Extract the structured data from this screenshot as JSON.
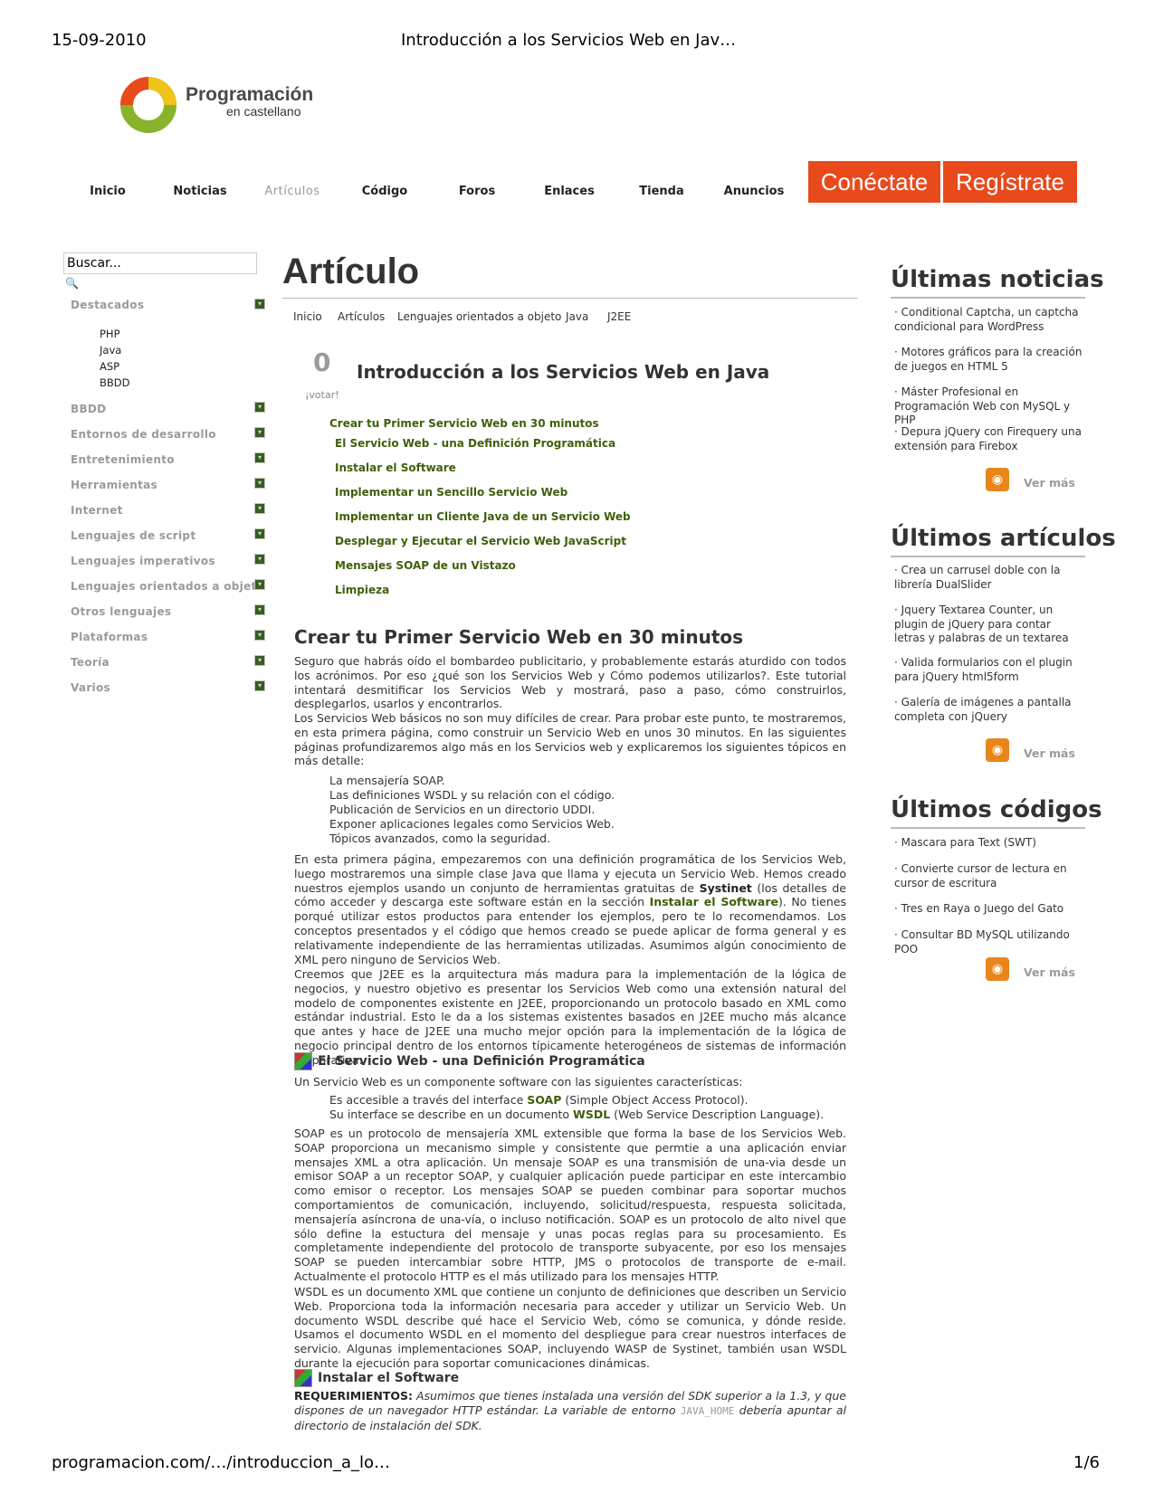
{
  "print": {
    "date": "15-09-2010",
    "doc_title": "Introducción a los Servicios Web en Jav…",
    "url": "programacion.com/…/introduccion_a_lo…",
    "page": "1/6"
  },
  "logo": {
    "line1": "Programación",
    "line2": "en castellano"
  },
  "nav": {
    "items": [
      "Inicio",
      "Noticias",
      "Artículos",
      "Código",
      "Foros",
      "Enlaces",
      "Tienda",
      "Anuncios"
    ],
    "connect": "Conéctate",
    "register": "Regístrate"
  },
  "sidebar": {
    "search_value": "Buscar...",
    "categories": [
      "Destacados",
      "BBDD",
      "Entornos de desarrollo",
      "Entretenimiento",
      "Herramientas",
      "Internet",
      "Lenguajes de script",
      "Lenguajes imperativos",
      "Lenguajes orientados a objeto",
      "Otros lenguajes",
      "Plataformas",
      "Teoría",
      "Varios"
    ],
    "sub_items": [
      "PHP",
      "Java",
      "ASP",
      "BBDD"
    ]
  },
  "main": {
    "title": "Artículo",
    "breadcrumb": [
      "Inicio",
      "Artículos",
      "Lenguajes orientados a objeto",
      "Java",
      "J2EE"
    ],
    "vote_count": "0",
    "vote_label": "¡votar!",
    "article_title": "Introducción a los Servicios Web en Java",
    "toc": [
      "Crear tu Primer Servicio Web en 30 minutos",
      "El Servicio Web - una Definición Programática",
      "Instalar el Software",
      "Implementar un Sencillo Servicio Web",
      "Implementar un Cliente Java de un Servicio Web",
      "Desplegar y Ejecutar el Servicio Web JavaScript",
      "Mensajes SOAP de un Vistazo",
      "Limpieza"
    ],
    "h2": "Crear tu Primer Servicio Web en 30 minutos",
    "p1": "Seguro que habrás oído el bombardeo publicitario, y probablemente estarás aturdido con todos los acrónimos. Por eso ¿qué son los Servicios Web y Cómo podemos utilizarlos?. Este tutorial intentará desmitificar los Servicios Web y mostrará, paso a paso, cómo construirlos, desplegarlos, usarlos y encontrarlos.",
    "p2": "Los Servicios Web básicos no son muy difíciles de crear. Para probar este punto, te mostraremos, en esta primera página, como construir un Servicio Web en unos 30 minutos. En las siguientes páginas profundizaremos algo más en los Servicios web y explicaremos los siguientes tópicos en más detalle:",
    "list1": [
      "La mensajería SOAP.",
      "Las definiciones WSDL y su relación con el código.",
      "Publicación de Servicios en un directorio UDDI.",
      "Exponer aplicaciones legales como Servicios Web.",
      "Tópicos avanzados, como la seguridad."
    ],
    "p3a": "En esta primera página, empezaremos con una definición programática de los Servicios Web, luego mostraremos una simple clase Java que llama y ejecuta un Servicio Web. Hemos creado nuestros ejemplos usando un conjunto de herramientas gratuitas de ",
    "p3_systinet": "Systinet",
    "p3b": " (los detalles de cómo acceder y descarga este software están en la sección ",
    "p3_link": "Instalar el Software",
    "p3c": "). No tienes porqué utilizar estos productos para entender los ejemplos, pero te lo recomendamos. Los conceptos presentados y el código que hemos creado se puede aplicar de forma general y es relativamente independiente de las herramientas utilizadas. Asumimos algún conocimiento de XML pero ninguno de Servicios Web.",
    "p4": "Creemos que J2EE es la arquitectura más madura para la implementación de la lógica de negocios, y nuestro objetivo es presentar los Servicios Web como una extensión natural del modelo de componentes existente en J2EE, proporcionando un protocolo basado en XML como estándar industrial. Esto le da a los sistemas existentes basados en J2EE mucho más alcance que antes y hace de J2EE una mucho mejor opción para la implementación de la lógica de negocio principal dentro de los entornos típicamente heterogéneos de sistemas de información corporativa.",
    "h3a": "El Servicio Web - una Definición Programática",
    "p5": "Un Servicio Web es un componente software con las siguientes características:",
    "li2a_pre": "Es accesible a través del interface ",
    "li2a_kw": "SOAP",
    "li2a_post": " (Simple Object Access Protocol).",
    "li2b_pre": "Su interface se describe en un documento ",
    "li2b_kw": "WSDL",
    "li2b_post": " (Web Service Description Language).",
    "p6": "SOAP es un protocolo de mensajería XML extensible que forma la base de los Servicios Web. SOAP proporciona un mecanismo simple y consistente que permtie a una aplicación enviar mensajes XML a otra aplicación. Un mensaje SOAP es una transmisión de una-via desde un emisor SOAP a un receptor SOAP, y cualquier aplicación puede participar en este intercambio como emisor o receptor. Los mensajes SOAP se pueden combinar para soportar muchos comportamientos de comunicación, incluyendo, solicitud/respuesta, respuesta solicitada, mensajería asíncrona de una-vía, o incluso notificación. SOAP es un protocolo de alto nivel que sólo define la estuctura del mensaje y unas pocas reglas para su procesamiento. Es completamente independiente del protocolo de transporte subyacente, por eso los mensajes SOAP se pueden intercambiar sobre HTTP, JMS o protocolos de transporte de e-mail. Actualmente el protocolo HTTP es el más utilizado para los mensajes HTTP.",
    "p7": "WSDL es un documento XML que contiene un conjunto de definiciones que describen un Servicio Web. Proporciona toda la información necesaria para acceder y utilizar un Servicio Web. Un documento WSDL describe qué hace el Servicio Web, cómo se comunica, y dónde reside. Usamos el documento WSDL en el momento del despliegue para crear nuestros interfaces de servicio. Algunas implementaciones SOAP, incluyendo WASP de Systinet, también usan WSDL durante la ejecución para soportar comunicaciones dinámicas.",
    "h3b": "Instalar el Software",
    "req_label": "REQUERIMIENTOS:",
    "req_text_a": " Asumimos que tienes instalada una versión del SDK superior a la 1.3, y que dispones de un navegador HTTP estándar. La variable de entorno ",
    "req_code": "JAVA_HOME",
    "req_text_b": " debería apuntar al directorio de instalación del SDK."
  },
  "right": {
    "news_title": "Últimas noticias",
    "news": [
      "Conditional Captcha, un captcha condicional para WordPress",
      "Motores gráficos para la creación de juegos en HTML 5",
      "Máster Profesional en Programación Web con MySQL y PHP",
      "Depura jQuery con Firequery una extensión para Firebox"
    ],
    "articles_title": "Últimos artículos",
    "articles": [
      "Crea un carrusel doble con la librería DualSlider",
      "Jquery Textarea Counter, un plugin de jQuery para contar letras y palabras de un textarea",
      "Valida formularios con el plugin para jQuery html5form",
      "Galería de imágenes a pantalla completa con jQuery"
    ],
    "codes_title": "Últimos códigos",
    "codes": [
      "Mascara para Text (SWT)",
      "Convierte cursor de lectura en cursor de escritura",
      "Tres en Raya o Juego del Gato",
      "Consultar BD MySQL utilizando POO"
    ],
    "ver_mas": "Ver más"
  },
  "colors": {
    "accent_red": "#e84a1c",
    "link_green": "#3e5f0a",
    "rss_orange": "#e8861c"
  },
  "icons": [
    "logo-ring-icon",
    "search-icon",
    "expand-icon",
    "rss-icon",
    "image-icon"
  ]
}
